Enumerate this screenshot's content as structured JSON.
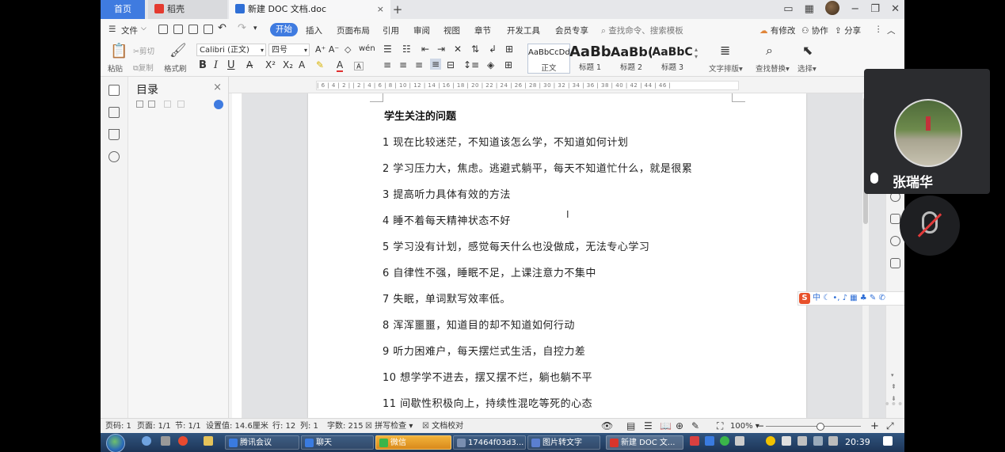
{
  "tabs": {
    "home": "首页",
    "daoke": "稻壳",
    "doc": "新建 DOC 文档.doc",
    "close": "×",
    "add": "+"
  },
  "window_controls": {
    "minimize": "−",
    "restore": "❐",
    "close": "✕"
  },
  "menu": {
    "file": "文件",
    "items": [
      "开始",
      "插入",
      "页面布局",
      "引用",
      "审阅",
      "视图",
      "章节",
      "开发工具",
      "会员专享"
    ],
    "search_placeholder": "查找命令、搜索模板",
    "right": [
      "有修改",
      "协作",
      "分享"
    ]
  },
  "ribbon": {
    "paste": "粘贴",
    "cut": "剪切",
    "copy": "复制",
    "format_painter": "格式刷",
    "font_name": "Calibri (正文)",
    "font_size": "四号",
    "bold": "B",
    "italic": "I",
    "underline": "U",
    "styles": [
      {
        "preview": "AaBbCcDd",
        "label": "正文"
      },
      {
        "preview": "AaBb",
        "label": "标题 1"
      },
      {
        "preview": "AaBb(",
        "label": "标题 2"
      },
      {
        "preview": "AaBbC",
        "label": "标题 3"
      }
    ],
    "text_layout": "文字排版",
    "find_replace": "查找替换",
    "select": "选择"
  },
  "toc": {
    "title": "目录",
    "close": "×"
  },
  "ruler_ticks": "| 6 | 4 | 2 |   | 2 | 4 | 6 | 8 | 10 | 12 | 14 | 16 | 18 | 20 | 22 | 24 | 26 | 28 | 30 | 32 | 34 | 36 | 38 | 40 | 42 | 44 | 46 |",
  "document": {
    "heading": "学生关注的问题",
    "lines": [
      "1 现在比较迷茫，不知道该怎么学，不知道如何计划",
      "2 学习压力大，焦虑。逃避式躺平，每天不知道忙什么，就是很累",
      "3 提高听力具体有效的方法",
      "4 睡不着每天精神状态不好",
      "5 学习没有计划，感觉每天什么也没做成，无法专心学习",
      "6 自律性不强，睡眠不足，上课注意力不集中",
      "7 失眠，单词默写效率低。",
      "8 浑浑噩噩，知道目的却不知道如何行动",
      "9 听力困难户，每天摆烂式生活，自控力差",
      "10 想学学不进去，摆又摆不烂，躺也躺不平",
      "11 间歇性积极向上，持续性混吃等死的心态"
    ],
    "caret": "I"
  },
  "ime": {
    "logo": "S",
    "mode": "中"
  },
  "status": {
    "page_code": "页码: 1",
    "page": "页面: 1/1",
    "section": "节: 1/1",
    "setting": "设置值: 14.6厘米",
    "row": "行: 12",
    "col": "列: 1",
    "words": "字数: 215",
    "spell": "拼写检查",
    "proof": "文档校对",
    "zoom": "100%"
  },
  "taskbar": {
    "items": [
      "腾讯会议",
      "聊天",
      "微信",
      "17464f03d3...",
      "图片转文字",
      "新建 DOC 文..."
    ],
    "clock": "20:39"
  },
  "meeting": {
    "speaker": "张瑞华",
    "more": "•••"
  }
}
